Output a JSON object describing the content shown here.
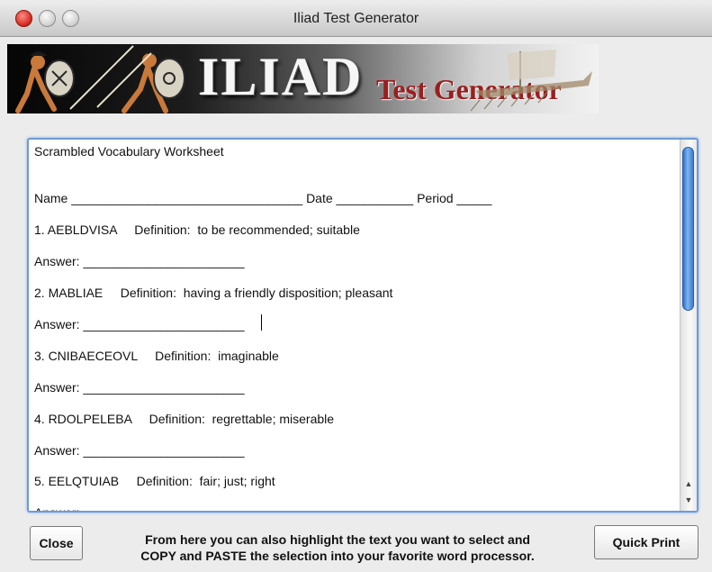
{
  "window": {
    "title": "Iliad Test Generator"
  },
  "banner": {
    "title": "ILIAD",
    "subtitle": "Test Generator"
  },
  "worksheet": {
    "lines": [
      "Scrambled Vocabulary Worksheet",
      "Name _________________________________ Date ___________ Period _____",
      "1. AEBLDVISA     Definition:  to be recommended; suitable",
      "Answer: _______________________",
      "2. MABLIAE     Definition:  having a friendly disposition; pleasant",
      "Answer: _______________________",
      "3. CNIBAECEOVL     Definition:  imaginable",
      "Answer: _______________________",
      "4. RDOLPELEBA     Definition:  regrettable; miserable",
      "Answer: _______________________",
      "5. EELQTUIAB     Definition:  fair; just; right",
      "Answer:"
    ]
  },
  "buttons": {
    "close": "Close",
    "quick_print": "Quick Print"
  },
  "hint": {
    "line1": "From here you can also highlight the text you want to select and",
    "line2": "COPY and PASTE the selection into your favorite word processor."
  },
  "colors": {
    "accent": "#6f9bd4",
    "brand_red": "#9c1e1e"
  },
  "icons": {
    "scroll_up": "chevron-up-icon",
    "scroll_down": "chevron-down-icon"
  }
}
